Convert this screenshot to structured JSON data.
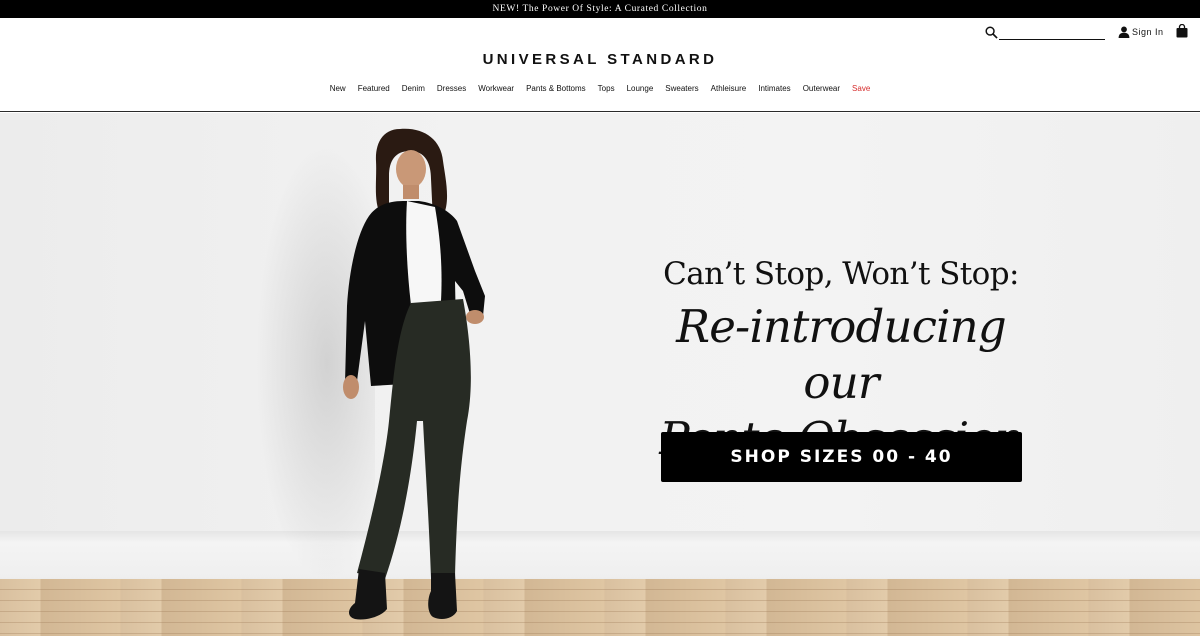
{
  "announcement": {
    "text": "NEW! The Power Of Style: A Curated Collection"
  },
  "header": {
    "logo": "UNIVERSAL STANDARD",
    "search": {
      "value": "",
      "placeholder": "",
      "icon": "search-icon"
    },
    "sign_in": {
      "label": "Sign In",
      "icon": "user-icon"
    },
    "bag": {
      "icon": "shopping-bag-icon"
    }
  },
  "nav": {
    "items": [
      {
        "label": "New"
      },
      {
        "label": "Featured"
      },
      {
        "label": "Denim"
      },
      {
        "label": "Dresses"
      },
      {
        "label": "Workwear"
      },
      {
        "label": "Pants & Bottoms"
      },
      {
        "label": "Tops"
      },
      {
        "label": "Lounge"
      },
      {
        "label": "Sweaters"
      },
      {
        "label": "Athleisure"
      },
      {
        "label": "Intimates"
      },
      {
        "label": "Outerwear"
      },
      {
        "label": "Save"
      }
    ],
    "sale_color": "#d62b2b"
  },
  "hero": {
    "kicker": "Can’t Stop, Won’t Stop:",
    "title_line1": "Re-introducing our",
    "title_line2": "Ponte Obsession",
    "cta": "SHOP SIZES 00 - 40"
  },
  "colors": {
    "announcement_bg": "#000000",
    "cta_bg": "#000000",
    "text": "#111111"
  }
}
